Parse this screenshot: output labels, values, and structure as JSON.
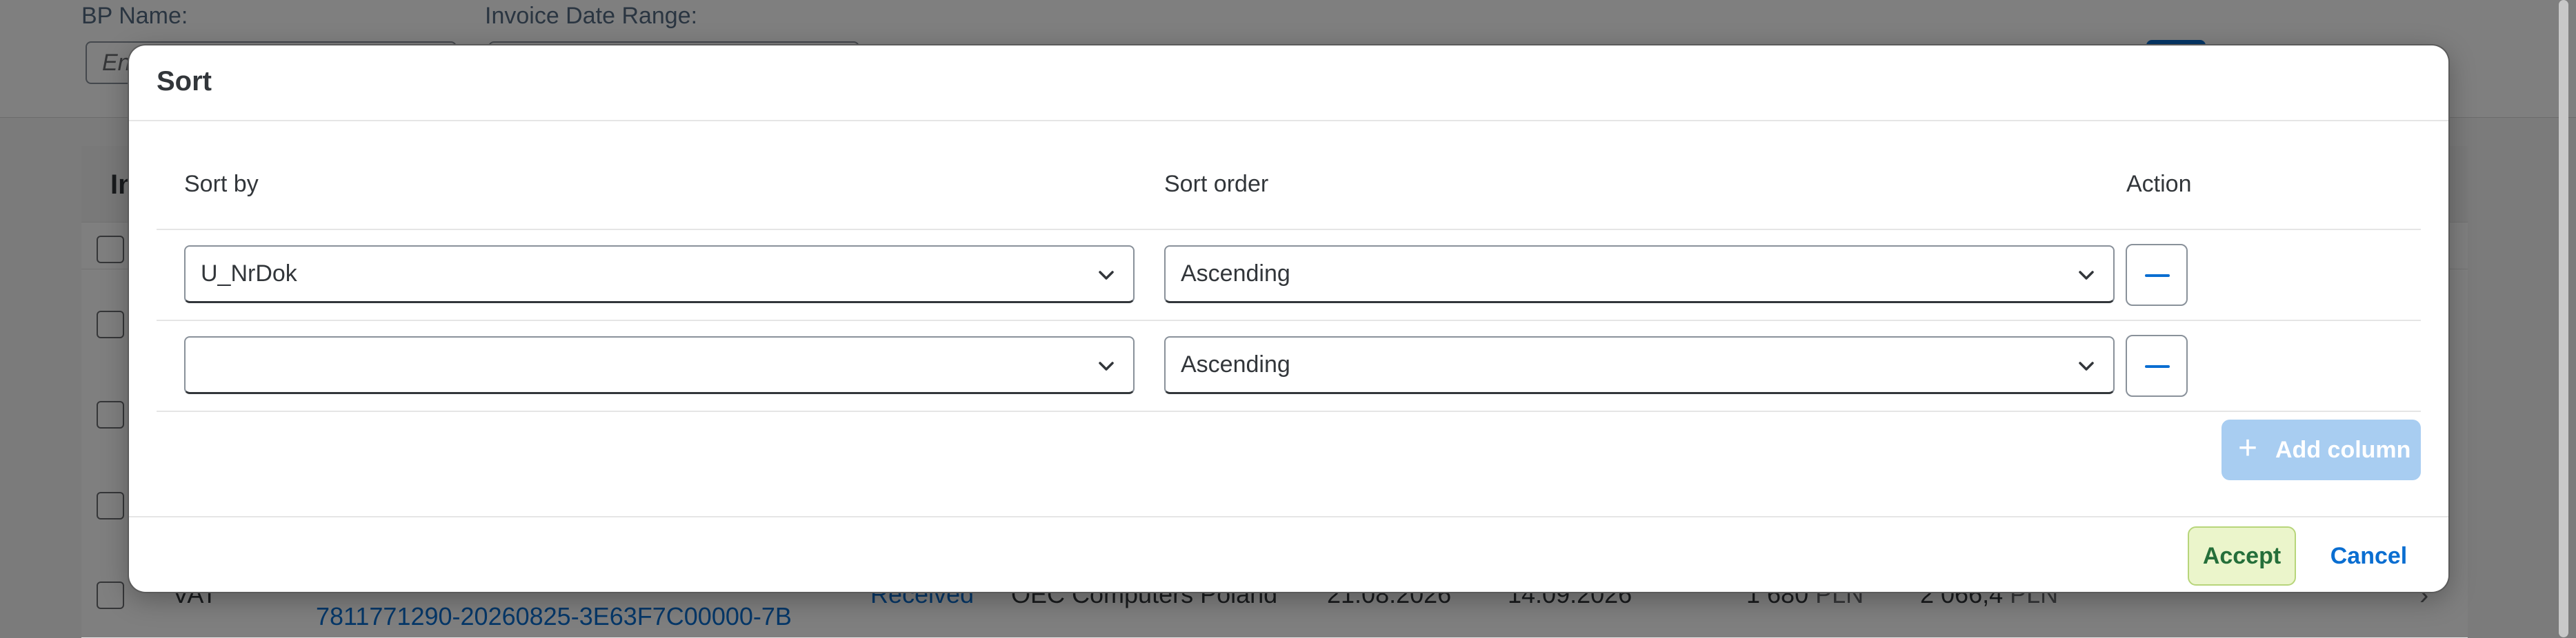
{
  "background": {
    "filters": [
      {
        "label": "BP Name:",
        "placeholder": "En"
      },
      {
        "label": "Invoice Date Range:",
        "placeholder": ""
      }
    ],
    "table": {
      "header_first": "In",
      "last_row": {
        "type": "VAT",
        "doc_number": "7811771290-20260825-3E63F7C00000-7B",
        "status": "Received",
        "partner": "OEC Computers Poland",
        "date1": "21.08.2026",
        "date2": "14.09.2026",
        "amount_net": "1 680",
        "amount_net_unit": "PLN",
        "amount_gross": "2 066,4",
        "amount_gross_unit": "PLN"
      }
    }
  },
  "dialog": {
    "title": "Sort",
    "columns": {
      "sort_by": "Sort by",
      "sort_order": "Sort order",
      "action": "Action"
    },
    "rows": [
      {
        "sort_by": "U_NrDok",
        "sort_order": "Ascending"
      },
      {
        "sort_by": "",
        "sort_order": "Ascending"
      }
    ],
    "add_column_label": "Add column",
    "accept_label": "Accept",
    "cancel_label": "Cancel"
  },
  "colors": {
    "accent": "#0a6ed1",
    "accept_bg": "#ebf5cb",
    "accept_text": "#256f3a",
    "add_column_bg": "#a8cdf1"
  },
  "icons": [
    "chevron-down-icon",
    "minus-icon",
    "plus-icon",
    "chevron-right-icon"
  ]
}
